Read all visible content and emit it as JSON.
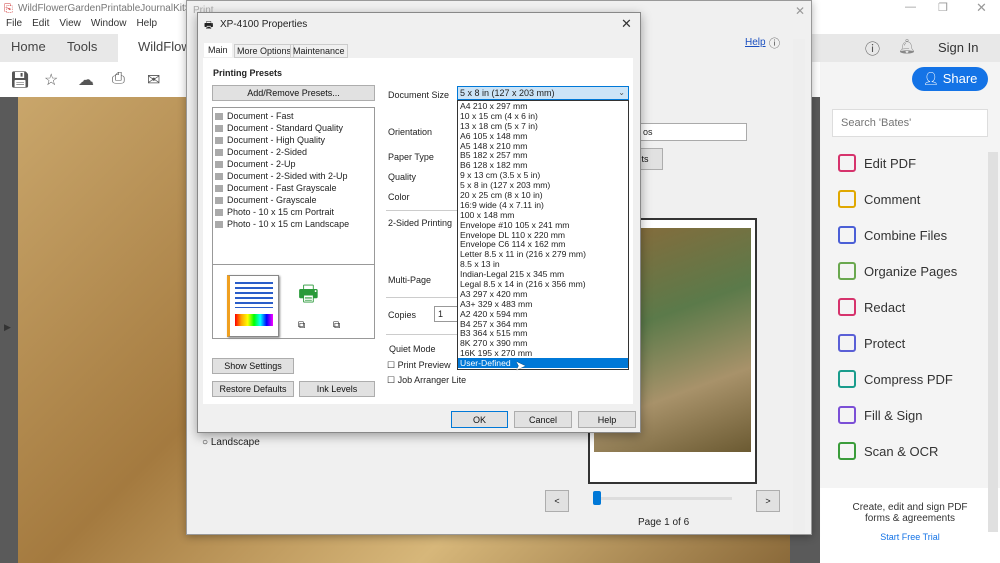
{
  "acrobat": {
    "title": "WildFlowerGardenPrintableJournalKitSam",
    "menu": [
      "File",
      "Edit",
      "View",
      "Window",
      "Help"
    ],
    "tabs": [
      "Home",
      "Tools",
      "WildFlowe"
    ],
    "sign_in": "Sign In",
    "share": "Share",
    "search_placeholder": "Search 'Bates'",
    "tools": [
      {
        "label": "Edit PDF",
        "color": "#d6336c"
      },
      {
        "label": "Comment",
        "color": "#e0a800"
      },
      {
        "label": "Combine Files",
        "color": "#4b5fd6"
      },
      {
        "label": "Organize Pages",
        "color": "#6aa84f"
      },
      {
        "label": "Redact",
        "color": "#d6336c"
      },
      {
        "label": "Protect",
        "color": "#5a5fd6"
      },
      {
        "label": "Compress PDF",
        "color": "#1a9c8c"
      },
      {
        "label": "Fill & Sign",
        "color": "#7b4fd6"
      },
      {
        "label": "Scan & OCR",
        "color": "#3a9c3a"
      }
    ],
    "promo": "Create, edit and sign PDF forms & agreements",
    "trial": "Start Free Trial"
  },
  "print": {
    "title": "Print",
    "help": "Help",
    "landscape": "Landscape",
    "page_label": "Page 1 of 6",
    "page_current": 1,
    "page_total": 6,
    "prev": "<",
    "next": ">",
    "partial_button": "ts",
    "partial_select": "os"
  },
  "props": {
    "title": "XP-4100 Properties",
    "tabs": [
      "Main",
      "More Options",
      "Maintenance"
    ],
    "presets_heading": "Printing Presets",
    "add_remove": "Add/Remove Presets...",
    "presets": [
      "Document - Fast",
      "Document - Standard Quality",
      "Document - High Quality",
      "Document - 2-Sided",
      "Document - 2-Up",
      "Document - 2-Sided with 2-Up",
      "Document - Fast Grayscale",
      "Document - Grayscale",
      "Photo - 10 x 15 cm Portrait",
      "Photo - 10 x 15 cm Landscape"
    ],
    "labels": {
      "doc_size": "Document Size",
      "orientation": "Orientation",
      "paper_type": "Paper Type",
      "quality": "Quality",
      "color": "Color",
      "two_sided": "2-Sided Printing",
      "multi_page": "Multi-Page",
      "copies": "Copies",
      "quiet": "Quiet Mode"
    },
    "copies": "1",
    "print_preview": "Print Preview",
    "job_arranger": "Job Arranger Lite",
    "show_settings": "Show Settings",
    "restore": "Restore Defaults",
    "ink": "Ink Levels",
    "ok": "OK",
    "cancel": "Cancel",
    "help": "Help",
    "doc_size_value": "5 x 8 in (127 x 203 mm)",
    "sizes": [
      "A4 210 x 297 mm",
      "10 x 15 cm (4 x 6 in)",
      "13 x 18 cm (5 x 7 in)",
      "A6 105 x 148 mm",
      "A5 148 x 210 mm",
      "B5 182 x 257 mm",
      "B6 128 x 182 mm",
      "9 x 13 cm (3.5 x 5 in)",
      "5 x 8 in (127 x 203 mm)",
      "20 x 25 cm (8 x 10 in)",
      "16:9 wide (4 x 7.11 in)",
      "100 x 148 mm",
      "Envelope #10 105 x 241 mm",
      "Envelope DL 110 x 220 mm",
      "Envelope C6  114 x 162 mm",
      "Letter 8.5 x 11 in (216 x 279 mm)",
      "8.5 x 13 in",
      "Indian-Legal 215 x 345 mm",
      "Legal 8.5 x 14 in (216 x 356 mm)",
      "A3 297 x 420 mm",
      "A3+ 329 x 483 mm",
      "A2 420 x 594 mm",
      "B4 257 x 364 mm",
      "B3 364 x 515 mm",
      "8K 270 x 390 mm",
      "16K 195 x 270 mm",
      "User-Defined"
    ],
    "highlighted": "User-Defined"
  }
}
